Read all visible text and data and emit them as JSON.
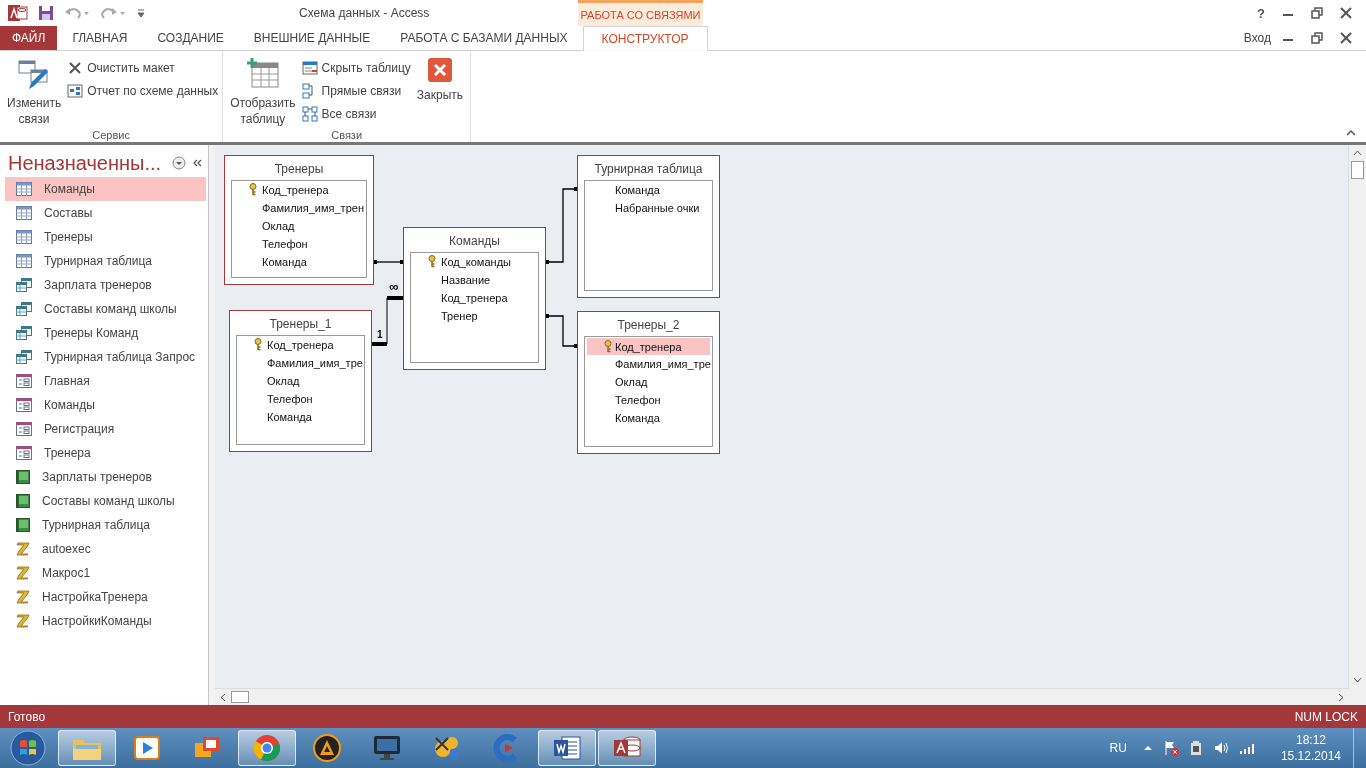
{
  "window": {
    "title": "Схема данных - Access",
    "context_tab": "РАБОТА СО СВЯЗЯМИ",
    "help": "?",
    "account": "Вход"
  },
  "tabs": [
    {
      "label": "ФАЙЛ",
      "kind": "file",
      "selected": false
    },
    {
      "label": "ГЛАВНАЯ",
      "kind": "normal",
      "selected": false
    },
    {
      "label": "СОЗДАНИЕ",
      "kind": "normal",
      "selected": false
    },
    {
      "label": "ВНЕШНИЕ ДАННЫЕ",
      "kind": "normal",
      "selected": false
    },
    {
      "label": "РАБОТА С БАЗАМИ ДАННЫХ",
      "kind": "normal",
      "selected": false
    },
    {
      "label": "КОНСТРУКТОР",
      "kind": "context",
      "selected": true
    }
  ],
  "ribbon": {
    "groups": [
      {
        "label": "Сервис",
        "buttons": [
          {
            "label": "Изменить связи",
            "kind": "large"
          },
          {
            "label": "Очистить макет",
            "kind": "small"
          },
          {
            "label": "Отчет по схеме данных",
            "kind": "small"
          }
        ]
      },
      {
        "label": "Связи",
        "buttons": [
          {
            "label": "Отобразить таблицу",
            "kind": "large"
          },
          {
            "label": "Скрыть таблицу",
            "kind": "small"
          },
          {
            "label": "Прямые связи",
            "kind": "small"
          },
          {
            "label": "Все связи",
            "kind": "small"
          },
          {
            "label": "Закрыть",
            "kind": "large"
          }
        ]
      }
    ]
  },
  "navigation": {
    "title": "Неназначенны...",
    "items": [
      {
        "label": "Команды",
        "kind": "table",
        "selected": true
      },
      {
        "label": "Составы",
        "kind": "table",
        "selected": false
      },
      {
        "label": "Тренеры",
        "kind": "table",
        "selected": false
      },
      {
        "label": "Турнирная таблица",
        "kind": "table",
        "selected": false
      },
      {
        "label": "Зарплата тренеров",
        "kind": "query",
        "selected": false
      },
      {
        "label": "Составы команд школы",
        "kind": "query",
        "selected": false
      },
      {
        "label": "Тренеры Команд",
        "kind": "query",
        "selected": false
      },
      {
        "label": "Турнирная таблица Запрос",
        "kind": "query",
        "selected": false
      },
      {
        "label": "Главная",
        "kind": "form",
        "selected": false
      },
      {
        "label": "Команды",
        "kind": "form",
        "selected": false
      },
      {
        "label": "Регистрация",
        "kind": "form",
        "selected": false
      },
      {
        "label": "Тренера",
        "kind": "form",
        "selected": false
      },
      {
        "label": "Зарплаты тренеров",
        "kind": "report",
        "selected": false
      },
      {
        "label": "Составы команд школы",
        "kind": "report",
        "selected": false
      },
      {
        "label": "Турнирная таблица",
        "kind": "report",
        "selected": false
      },
      {
        "label": "autoexec",
        "kind": "macro",
        "selected": false
      },
      {
        "label": "Макрос1",
        "kind": "macro",
        "selected": false
      },
      {
        "label": "НастройкаТренера",
        "kind": "macro",
        "selected": false
      },
      {
        "label": "НастройкиКоманды",
        "kind": "macro",
        "selected": false
      }
    ]
  },
  "diagram": {
    "tables": [
      {
        "title": "Тренеры",
        "fields": [
          {
            "name": "Код_тренера",
            "key": true,
            "selected": false
          },
          {
            "name": "Фамилия_имя_трен",
            "key": false,
            "selected": false
          },
          {
            "name": "Оклад",
            "key": false,
            "selected": false
          },
          {
            "name": "Телефон",
            "key": false,
            "selected": false
          },
          {
            "name": "Команда",
            "key": false,
            "selected": false
          }
        ]
      },
      {
        "title": "Турнирная таблица",
        "fields": [
          {
            "name": "Команда",
            "key": false,
            "selected": false
          },
          {
            "name": "Набранные очки",
            "key": false,
            "selected": false
          }
        ]
      },
      {
        "title": "Команды",
        "fields": [
          {
            "name": "Код_команды",
            "key": true,
            "selected": false
          },
          {
            "name": "Название",
            "key": false,
            "selected": false
          },
          {
            "name": "Код_тренера",
            "key": false,
            "selected": false
          },
          {
            "name": "Тренер",
            "key": false,
            "selected": false
          }
        ]
      },
      {
        "title": "Тренеры_1",
        "fields": [
          {
            "name": "Код_тренера",
            "key": true,
            "selected": false
          },
          {
            "name": "Фамилия_имя_тре",
            "key": false,
            "selected": false
          },
          {
            "name": "Оклад",
            "key": false,
            "selected": false
          },
          {
            "name": "Телефон",
            "key": false,
            "selected": false
          },
          {
            "name": "Команда",
            "key": false,
            "selected": false
          }
        ]
      },
      {
        "title": "Тренеры_2",
        "fields": [
          {
            "name": "Код_тренера",
            "key": true,
            "selected": true
          },
          {
            "name": "Фамилия_имя_тре",
            "key": false,
            "selected": false
          },
          {
            "name": "Оклад",
            "key": false,
            "selected": false
          },
          {
            "name": "Телефон",
            "key": false,
            "selected": false
          },
          {
            "name": "Команда",
            "key": false,
            "selected": false
          }
        ]
      }
    ],
    "relationships": [
      {
        "kind": "plain"
      },
      {
        "kind": "enforced",
        "one": "1",
        "many": "∞"
      },
      {
        "kind": "plain"
      },
      {
        "kind": "plain"
      }
    ]
  },
  "status_bar": {
    "left": "Готово",
    "right": "NUM LOCK"
  },
  "taskbar": {
    "items": [
      {
        "kind": "explorer",
        "running": true
      },
      {
        "kind": "player",
        "running": false
      },
      {
        "kind": "paint",
        "running": false
      },
      {
        "kind": "browser",
        "running": true
      },
      {
        "kind": "audio",
        "running": false
      },
      {
        "kind": "monitor",
        "running": false
      },
      {
        "kind": "tools",
        "running": false
      },
      {
        "kind": "cleaner",
        "running": false
      },
      {
        "kind": "word",
        "running": true
      },
      {
        "kind": "access",
        "running": true
      }
    ],
    "language": "RU",
    "time": "18:12",
    "date": "15.12.2014"
  }
}
